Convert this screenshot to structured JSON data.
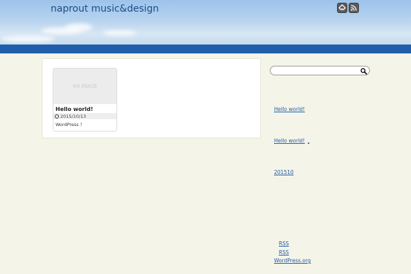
{
  "header": {
    "site_title": "naprout music&design",
    "icons": [
      "feedly-icon",
      "rss-icon"
    ]
  },
  "colors": {
    "navbar": "#1f5eab",
    "link": "#1f5eab",
    "page_bg": "#f5f4e8"
  },
  "main": {
    "posts": [
      {
        "thumbnail_text": "NO IMAGE",
        "title": "Hello world!",
        "date": "2015/10/13",
        "excerpt": "WordPress ！"
      }
    ]
  },
  "sidebar": {
    "search": {
      "value": "",
      "placeholder": ""
    },
    "recent_post": "Hello world!",
    "recent_comment": "Hello world!",
    "archive": "201510",
    "meta": [
      "RSS",
      "RSS",
      "WordPress.org"
    ]
  }
}
